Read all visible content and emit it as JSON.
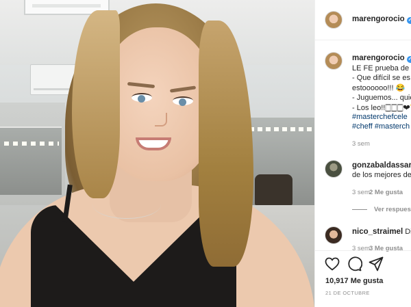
{
  "post": {
    "author": "marengorocio",
    "verified_icon": "verified-check-icon"
  },
  "caption": {
    "author": "marengorocio",
    "lines": [
      "LE FE prueba de s",
      "- Que difícil se es",
      "estoooooo!!! 😂",
      "- Juguemos... quie",
      "- Los leo!!🀆🀆🀆❤🏆",
      "#masterchefcele",
      "#cheff #masterch"
    ],
    "time": "3 sem"
  },
  "comments": [
    {
      "author": "gonzabaldassarre",
      "text": "de los mejores de",
      "time": "3 sem",
      "likes": "2 Me gusta",
      "view_replies": "Ver respuest"
    },
    {
      "author": "nico_straimel",
      "text": "Dio",
      "time": "3 sem",
      "likes": "3 Me gusta"
    }
  ],
  "actions": {
    "like_icon": "heart-icon",
    "comment_icon": "comment-icon",
    "share_icon": "share-icon"
  },
  "stats": {
    "likes": "10,917 Me gusta",
    "date": "21 DE OCTUBRE"
  },
  "colors": {
    "verified": "#3897f0",
    "hashtag": "#00376b",
    "muted": "#8e8e8e"
  }
}
